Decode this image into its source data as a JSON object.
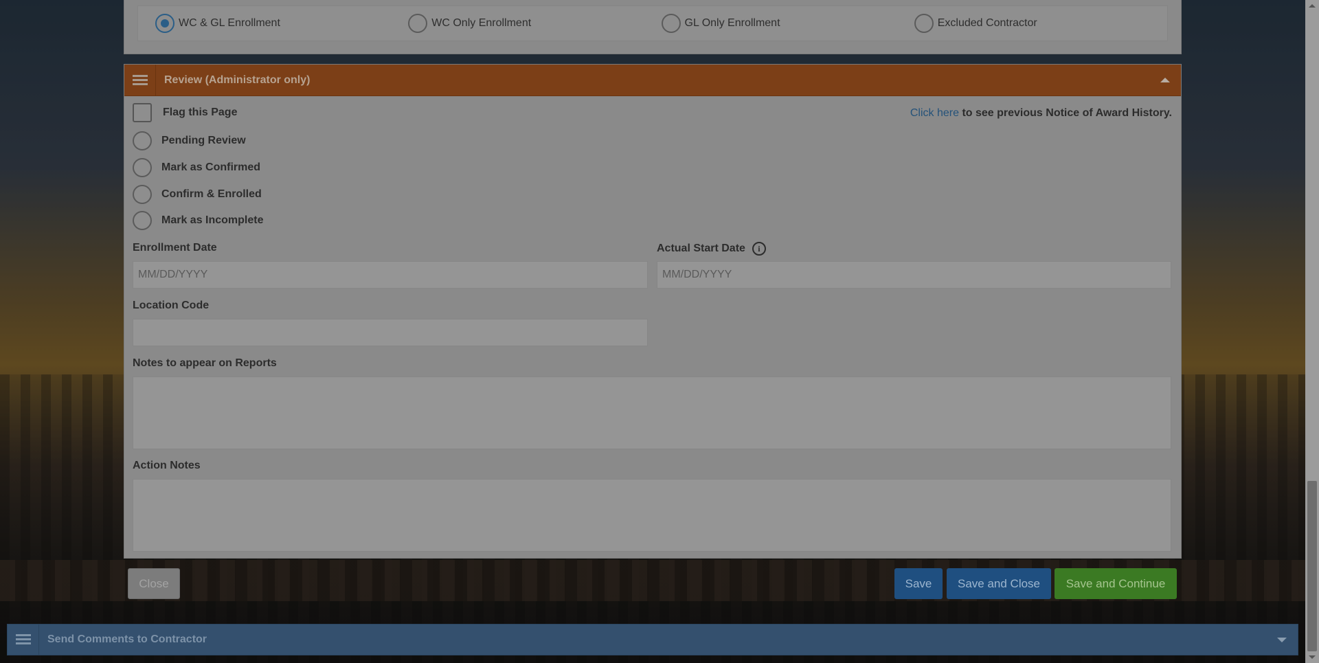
{
  "enrollment_type": {
    "options": [
      {
        "label": "WC & GL Enrollment",
        "checked": true
      },
      {
        "label": "WC Only Enrollment",
        "checked": false
      },
      {
        "label": "GL Only Enrollment",
        "checked": false
      },
      {
        "label": "Excluded Contractor",
        "checked": false
      }
    ]
  },
  "review": {
    "title": "Review (Administrator only)",
    "flag_label": "Flag this Page",
    "history_link": "Click here",
    "history_text": " to see previous Notice of Award History.",
    "statuses": [
      "Pending Review",
      "Mark as Confirmed",
      "Confirm & Enrolled",
      "Mark as Incomplete"
    ],
    "enrollment_date_label": "Enrollment Date",
    "enrollment_date_placeholder": "MM/DD/YYYY",
    "actual_start_date_label": "Actual Start Date",
    "actual_start_date_placeholder": "MM/DD/YYYY",
    "location_code_label": "Location Code",
    "location_code_value": "",
    "notes_label": "Notes to appear on Reports",
    "notes_value": "",
    "action_notes_label": "Action Notes",
    "action_notes_value": ""
  },
  "footer": {
    "close": "Close",
    "save": "Save",
    "save_close": "Save and Close",
    "save_continue": "Save and Continue"
  },
  "comments": {
    "title": "Send Comments to Contractor"
  },
  "colors": {
    "review_header": "#7c3f17",
    "comments_header": "#34506e",
    "primary_button": "#1f4f80",
    "success_button": "#3b7a23",
    "link": "#24527a"
  }
}
